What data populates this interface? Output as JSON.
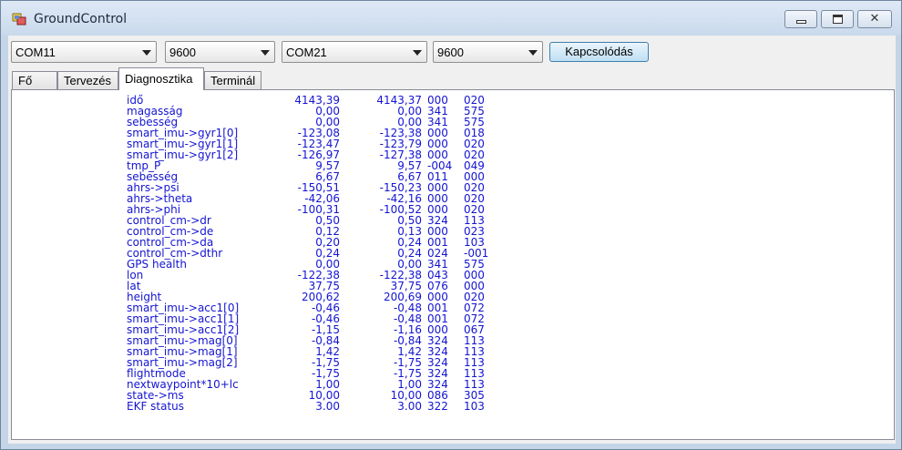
{
  "window": {
    "title": "GroundControl",
    "icon": "app-icon"
  },
  "toolbar": {
    "port1": "COM11",
    "baud1": "9600",
    "port2": "COM21",
    "baud2": "9600",
    "connect_label": "Kapcsolódás"
  },
  "tabs": [
    {
      "label": "Fő",
      "active": false
    },
    {
      "label": "Tervezés",
      "active": false
    },
    {
      "label": "Diagnosztika",
      "active": true
    },
    {
      "label": "Terminál",
      "active": false
    }
  ],
  "diagnostics": [
    {
      "name": "idő",
      "v1": "4143,39",
      "v2": "4143,37",
      "a": "000",
      "b": "020"
    },
    {
      "name": "magasság",
      "v1": "0,00",
      "v2": "0,00",
      "a": "341",
      "b": "575"
    },
    {
      "name": "sebesség",
      "v1": "0,00",
      "v2": "0,00",
      "a": "341",
      "b": "575"
    },
    {
      "name": "smart_imu->gyr1[0]",
      "v1": "-123,08",
      "v2": "-123,38",
      "a": "000",
      "b": "018"
    },
    {
      "name": "smart_imu->gyr1[1]",
      "v1": "-123,47",
      "v2": "-123,79",
      "a": "000",
      "b": "020"
    },
    {
      "name": "smart_imu->gyr1[2]",
      "v1": "-126,97",
      "v2": "-127,38",
      "a": "000",
      "b": "020"
    },
    {
      "name": "tmp_P",
      "v1": "9,57",
      "v2": "9,57",
      "a": "-004",
      "b": "049"
    },
    {
      "name": "sebesség",
      "v1": "6,67",
      "v2": "6,67",
      "a": "011",
      "b": "000"
    },
    {
      "name": "ahrs->psi",
      "v1": "-150,51",
      "v2": "-150,23",
      "a": "000",
      "b": "020"
    },
    {
      "name": "ahrs->theta",
      "v1": "-42,06",
      "v2": "-42,16",
      "a": "000",
      "b": "020"
    },
    {
      "name": "ahrs->phi",
      "v1": "-100,31",
      "v2": "-100,52",
      "a": "000",
      "b": "020"
    },
    {
      "name": "control_cm->dr",
      "v1": "0,50",
      "v2": "0,50",
      "a": "324",
      "b": "113"
    },
    {
      "name": "control_cm->de",
      "v1": "0,12",
      "v2": "0,13",
      "a": "000",
      "b": "023"
    },
    {
      "name": "control_cm->da",
      "v1": "0,20",
      "v2": "0,24",
      "a": "001",
      "b": "103"
    },
    {
      "name": "control_cm->dthr",
      "v1": "0,24",
      "v2": "0,24",
      "a": "024",
      "b": "-001"
    },
    {
      "name": "GPS health",
      "v1": "0,00",
      "v2": "0,00",
      "a": "341",
      "b": "575"
    },
    {
      "name": "lon",
      "v1": "-122,38",
      "v2": "-122,38",
      "a": "043",
      "b": "000"
    },
    {
      "name": "lat",
      "v1": "37,75",
      "v2": "37,75",
      "a": "076",
      "b": "000"
    },
    {
      "name": "height",
      "v1": "200,62",
      "v2": "200,69",
      "a": "000",
      "b": "020"
    },
    {
      "name": "smart_imu->acc1[0]",
      "v1": "-0,46",
      "v2": "-0,48",
      "a": "001",
      "b": "072"
    },
    {
      "name": "smart_imu->acc1[1]",
      "v1": "-0,46",
      "v2": "-0,48",
      "a": "001",
      "b": "072"
    },
    {
      "name": "smart_imu->acc1[2]",
      "v1": "-1,15",
      "v2": "-1,16",
      "a": "000",
      "b": "067"
    },
    {
      "name": "smart_imu->mag[0]",
      "v1": "-0,84",
      "v2": "-0,84",
      "a": "324",
      "b": "113"
    },
    {
      "name": "smart_imu->mag[1]",
      "v1": "1,42",
      "v2": "1,42",
      "a": "324",
      "b": "113"
    },
    {
      "name": "smart_imu->mag[2]",
      "v1": "-1,75",
      "v2": "-1,75",
      "a": "324",
      "b": "113"
    },
    {
      "name": "flightmode",
      "v1": "-1,75",
      "v2": "-1,75",
      "a": "324",
      "b": "113"
    },
    {
      "name": "nextwaypoint*10+lc",
      "v1": "1,00",
      "v2": "1,00",
      "a": "324",
      "b": "113"
    },
    {
      "name": "state->ms",
      "v1": "10,00",
      "v2": "10,00",
      "a": "086",
      "b": "305"
    },
    {
      "name": "EKF status",
      "v1": "3.00",
      "v2": "3.00",
      "a": "322",
      "b": "103"
    }
  ],
  "colors": {
    "value_text": "#1414d2",
    "titlebar": "#c9d9ec"
  }
}
